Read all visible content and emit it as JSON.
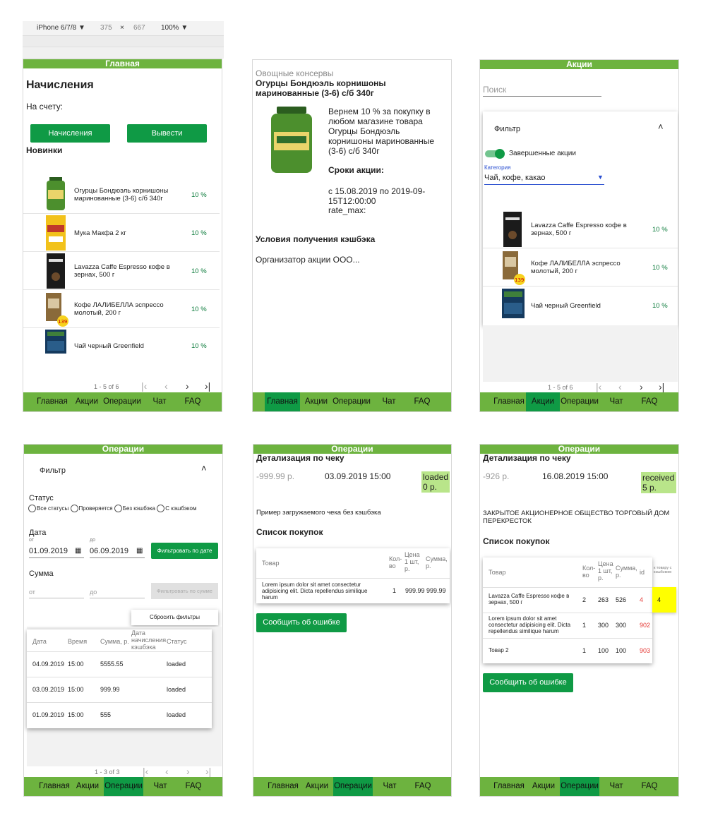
{
  "devtools": {
    "device": "iPhone 6/7/8",
    "width": "375",
    "times": "×",
    "height": "667",
    "zoom": "100%"
  },
  "nav": {
    "home": "Главная",
    "promos": "Акции",
    "ops": "Операции",
    "chat": "Чат",
    "faq": "FAQ"
  },
  "main": {
    "header": "Главная",
    "title": "Начисления",
    "balance_label": "На счету:",
    "btn_accruals": "Начисления",
    "btn_withdraw": "Вывести",
    "new_title": "Новинки",
    "products": [
      {
        "name": "Огурцы Бондюэль корнишоны маринованные (3-6) с/б 340г",
        "pct": "10 %"
      },
      {
        "name": "Мука Макфа 2 кг",
        "pct": "10 %"
      },
      {
        "name": "Lavazza Caffe Espresso кофе в зернах, 500 г",
        "pct": "10 %"
      },
      {
        "name": "Кофе ЛАЛИБЕЛЛА эспрессо молотый, 200 г",
        "pct": "10 %"
      },
      {
        "name": "Чай черный Greenfield",
        "pct": "10 %"
      }
    ],
    "pager": "1 - 5 of 6"
  },
  "detail": {
    "category": "Овощные консервы",
    "title": "Огурцы Бондюэль корнишоны маринованные (3-6) с/б 340г",
    "desc": "Вернем 10 % за покупку в любом магазине товара Огурцы Бондюэль корнишоны маринованные (3-6) с/б 340г",
    "terms_title": "Сроки акции:",
    "terms": "с 15.08.2019 по 2019-09-15T12:00:00",
    "rate": "rate_max:",
    "cond_title": "Условия получения кэшбэка",
    "organizer": "Организатор акции ООО..."
  },
  "promos": {
    "header": "Акции",
    "search_placeholder": "Поиск",
    "filter": "Фильтр",
    "switch_label": "Завершенные акции",
    "cat_label": "Категория",
    "cat_value": "Чай, кофе, какао",
    "products": [
      {
        "name": "Lavazza Caffe Espresso кофе в зернах, 500 г",
        "pct": "10 %"
      },
      {
        "name": "Кофе ЛАЛИБЕЛЛА эспрессо молотый, 200 г",
        "pct": "10 %"
      },
      {
        "name": "Чай черный Greenfield",
        "pct": "10 %"
      }
    ],
    "pager": "1 - 5 of 6"
  },
  "ops": {
    "header": "Операции",
    "filter": "Фильтр",
    "status_label": "Статус",
    "radios": [
      "Все статусы",
      "Проверяется",
      "Без кэшбэка",
      "С кэшбэком"
    ],
    "date_label": "Дата",
    "from": "от",
    "to": "до",
    "date_from": "01.09.2019",
    "date_to": "06.09.2019",
    "btn_filter_date": "Фильтровать по дате",
    "sum_label": "Сумма",
    "sum_from": "от",
    "sum_to": "до",
    "btn_filter_sum": "Фильтровать по сумме",
    "btn_reset": "Сбросить фильтры",
    "cols": [
      "Дата",
      "Время",
      "Сумма, р.",
      "Дата начисления кэшбэка",
      "Статус"
    ],
    "rows": [
      [
        "04.09.2019",
        "15:00",
        "5555.55",
        "",
        "loaded"
      ],
      [
        "03.09.2019",
        "15:00",
        "999.99",
        "",
        "loaded"
      ],
      [
        "01.09.2019",
        "15:00",
        "555",
        "",
        "loaded"
      ]
    ],
    "pager": "1 - 3 of 3"
  },
  "receipt1": {
    "header": "Операции",
    "title": "Детализация по чеку",
    "amount": "-999.99 р.",
    "date": "03.09.2019 15:00",
    "status": "loaded",
    "status_sum": "0 р.",
    "store": "Пример загружаемого чека без кэшбэка",
    "list_title": "Список покупок",
    "cols": [
      "Товар",
      "Кол-во",
      "Цена 1 шт, р.",
      "Сумма, р."
    ],
    "rows": [
      [
        "Lorem ipsum dolor sit amet consectetur adipisicing elit. Dicta repellendus similique harum",
        "1",
        "999.99",
        "999.99"
      ]
    ],
    "btn_report": "Сообщить об ошибке"
  },
  "receipt2": {
    "header": "Операции",
    "title": "Детализация по чеку",
    "amount": "-926 р.",
    "date": "16.08.2019 15:00",
    "status": "received",
    "status_sum": "5 р.",
    "store": "ЗАКРЫТОЕ АКЦИОНЕРНОЕ ОБЩЕСТВО ТОРГОВЫЙ ДОМ ПЕРЕКРЕСТОК",
    "list_title": "Список покупок",
    "cols": [
      "Товар",
      "Кол-во",
      "Цена 1 шт, р.",
      "Сумма, р.",
      "id",
      "к товару с кэшбэком"
    ],
    "rows": [
      [
        "Lavazza Caffe Espresso кофе в зернах, 500 г",
        "2",
        "263",
        "526",
        "4",
        "4"
      ],
      [
        "Lorem ipsum dolor sit amet consectetur adipisicing elit. Dicta repellendus similique harum",
        "1",
        "300",
        "300",
        "902",
        ""
      ],
      [
        "Товар 2",
        "1",
        "100",
        "100",
        "903",
        ""
      ]
    ],
    "btn_report": "Сообщить об ошибке"
  },
  "colors": {
    "green_bar": "#6db33f",
    "green_button": "#0f9a45",
    "status_badge": "#b9e58a",
    "highlight": "#ffff00",
    "red_id": "#e53935"
  }
}
